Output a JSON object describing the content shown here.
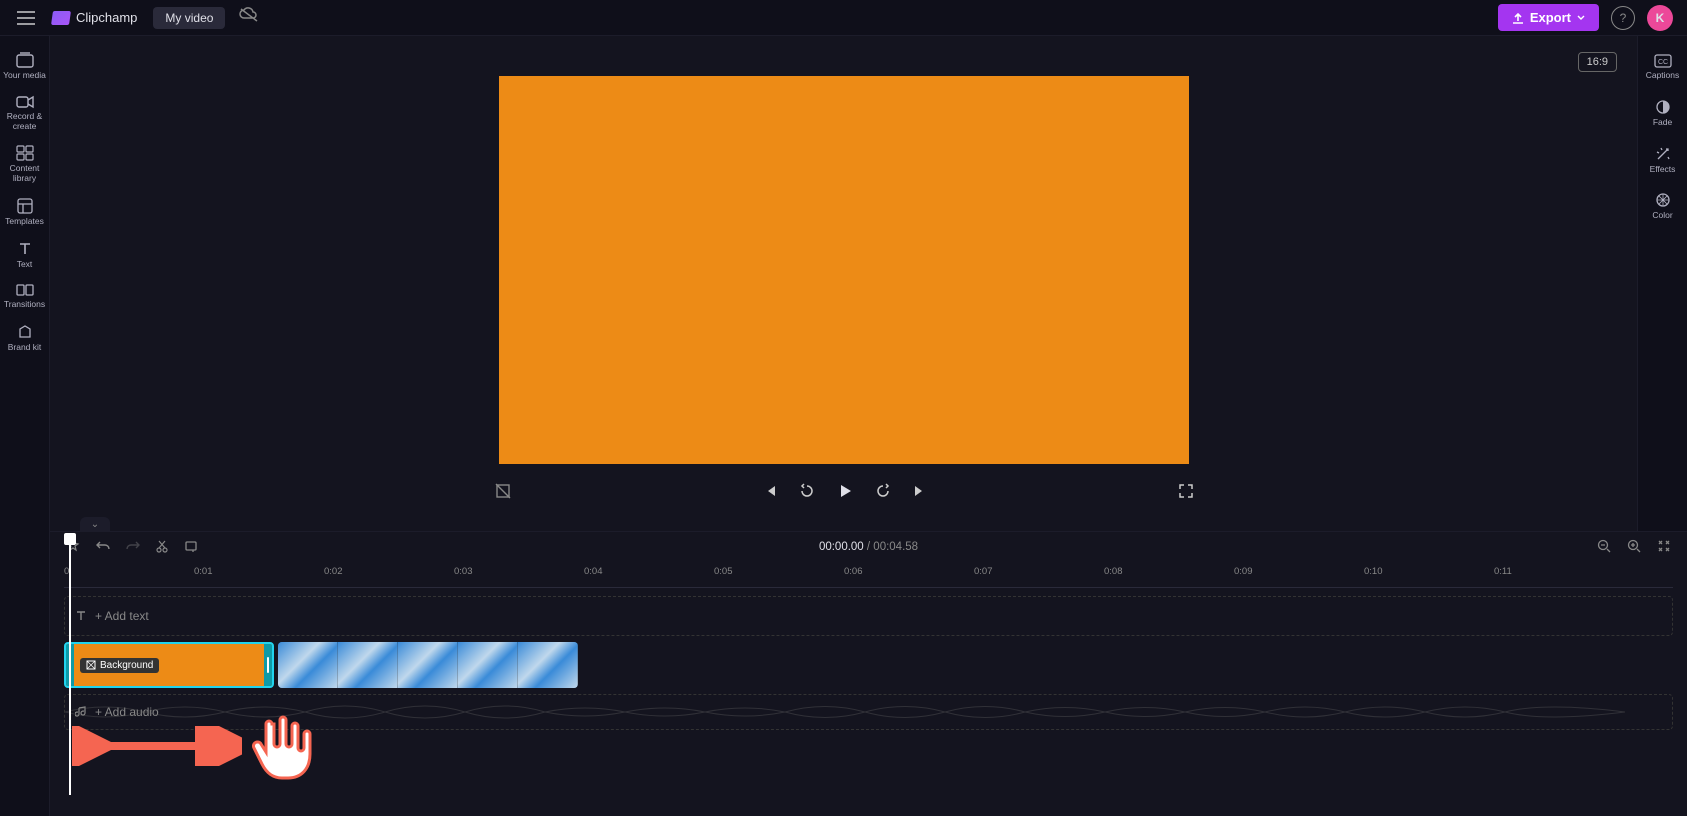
{
  "header": {
    "app_name": "Clipchamp",
    "project_name": "My video",
    "export_label": "Export",
    "avatar_initial": "K"
  },
  "left_sidebar": {
    "items": [
      {
        "label": "Your media"
      },
      {
        "label": "Record & create"
      },
      {
        "label": "Content library"
      },
      {
        "label": "Templates"
      },
      {
        "label": "Text"
      },
      {
        "label": "Transitions"
      },
      {
        "label": "Brand kit"
      }
    ]
  },
  "right_sidebar": {
    "items": [
      {
        "label": "Captions"
      },
      {
        "label": "Fade"
      },
      {
        "label": "Effects"
      },
      {
        "label": "Color"
      }
    ]
  },
  "preview": {
    "aspect_ratio": "16:9",
    "canvas_color": "#ed8b16"
  },
  "timeline": {
    "current_time": "00:00.00",
    "total_time": "00:04.58",
    "ruler_ticks": [
      "0",
      "0:01",
      "0:02",
      "0:03",
      "0:04",
      "0:05",
      "0:06",
      "0:07",
      "0:08",
      "0:09",
      "0:10",
      "0:11"
    ],
    "add_text_label": "+ Add text",
    "add_audio_label": "+ Add audio",
    "clip_bg_label": "Background"
  }
}
